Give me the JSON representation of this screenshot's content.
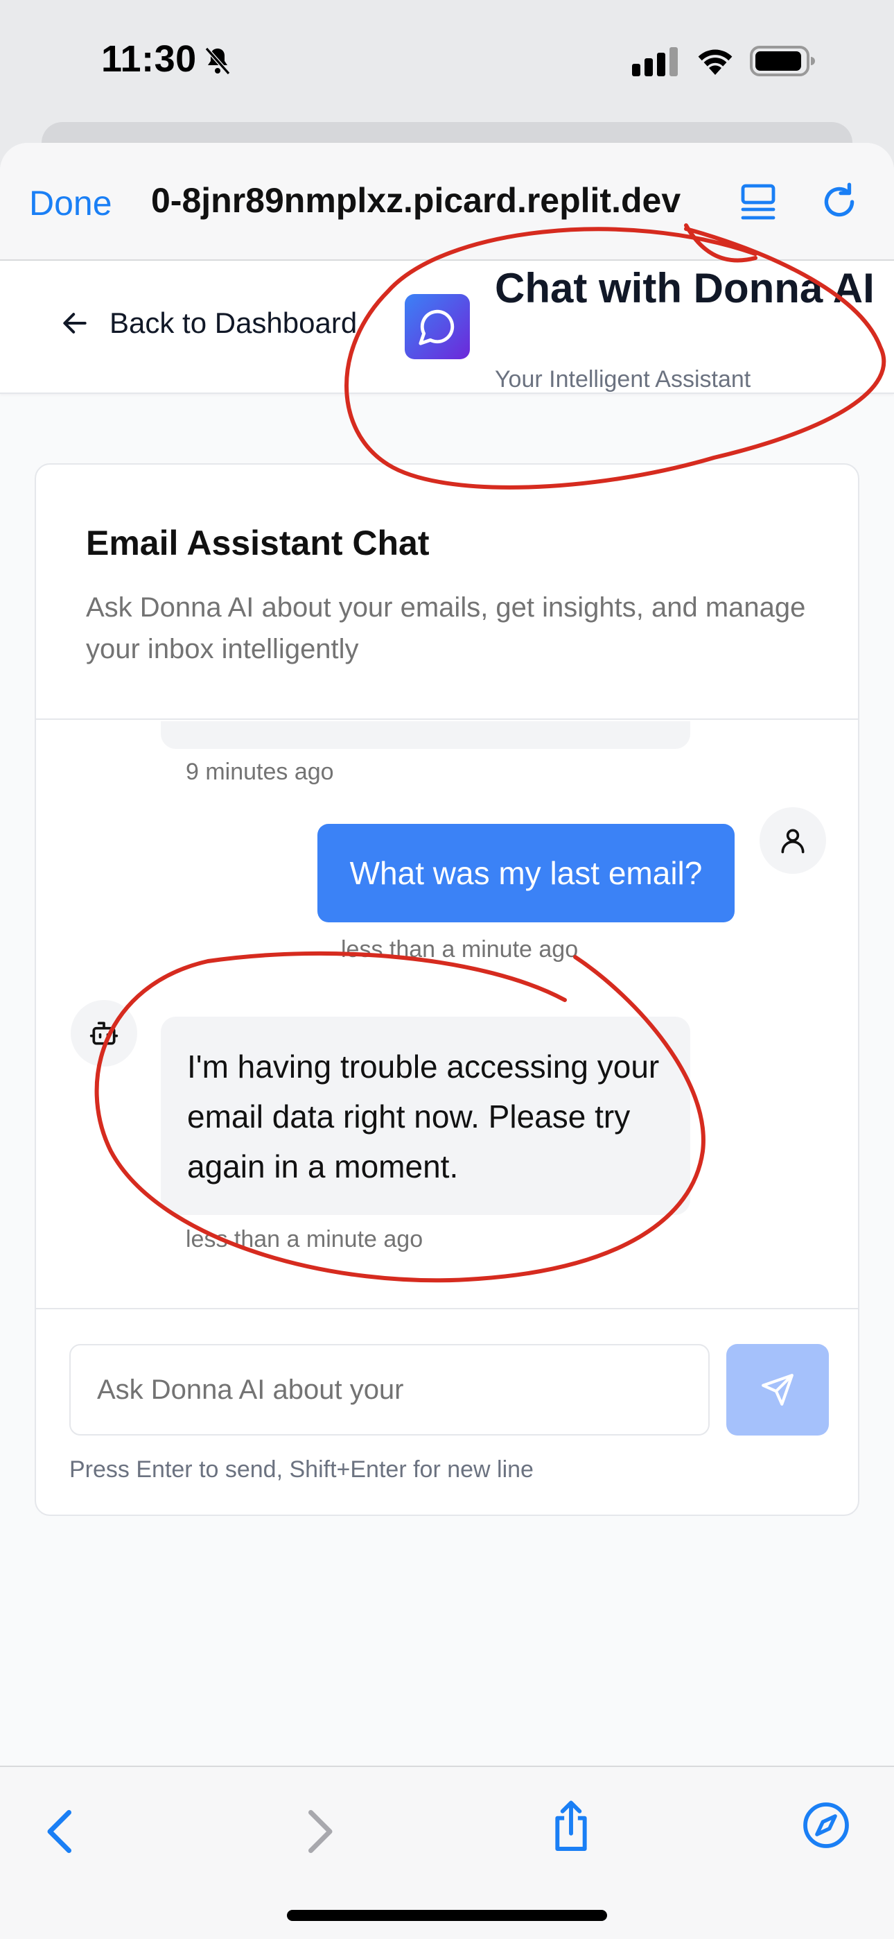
{
  "status_bar": {
    "time": "11:30"
  },
  "browser": {
    "done_label": "Done",
    "url": "0-8jnr89nmplxz.picard.replit.dev"
  },
  "header": {
    "back_label": "Back to Dashboard",
    "title": "Chat with Donna AI",
    "subtitle": "Your Intelligent Assistant"
  },
  "card": {
    "title": "Email Assistant Chat",
    "description": "Ask Donna AI about your emails, get insights, and manage your inbox intelligently"
  },
  "messages": {
    "previous_timestamp": "9 minutes ago",
    "user_message": "What was my last email?",
    "user_timestamp": "less than a minute ago",
    "bot_message": "I'm having trouble accessing your email data right now. Please try again in a moment.",
    "bot_timestamp": "less than a minute ago"
  },
  "composer": {
    "placeholder": "Ask Donna AI about your",
    "hint": "Press Enter to send, Shift+Enter for new line"
  },
  "colors": {
    "accent": "#3b82f6",
    "ios_blue": "#1a7ff5",
    "annotation": "#d62b1f"
  }
}
